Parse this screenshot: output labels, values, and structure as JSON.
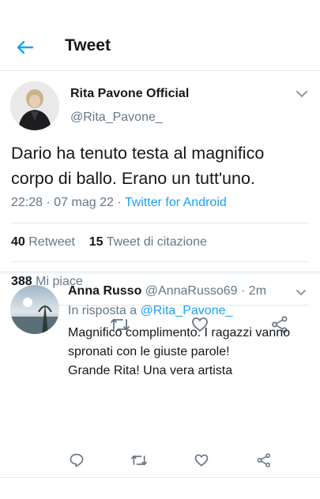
{
  "header": {
    "title": "Tweet",
    "back_icon": "arrow-left-icon",
    "accent_color": "#1da1f2"
  },
  "tweet": {
    "author_name": "Rita Pavone Official",
    "author_handle": "@Rita_Pavone_",
    "text": "Dario ha tenuto testa al magnifico corpo di ballo. Erano un tutt'uno.",
    "time": "22:28",
    "date": "07 mag 22",
    "source": "Twitter for Android",
    "retweet_count": "40",
    "retweet_label": "Retweet",
    "quote_count": "15",
    "quote_label": "Tweet di citazione",
    "like_count": "388",
    "like_label": "Mi piace",
    "actions": [
      "reply-icon",
      "retweet-icon",
      "like-icon",
      "share-icon"
    ]
  },
  "reply": {
    "author_name": "Anna Russo",
    "author_handle": "@AnnaRusso69",
    "age": "2m",
    "in_reply_prefix": "In risposta a",
    "in_reply_to": "@Rita_Pavone_",
    "text_lines": [
      "Magnifico complimento. I ragazzi vanno",
      "spronati con le giuste parole!",
      "Grande Rita! Una vera artista"
    ],
    "actions": [
      "reply-icon",
      "retweet-icon",
      "like-icon",
      "share-icon"
    ]
  }
}
